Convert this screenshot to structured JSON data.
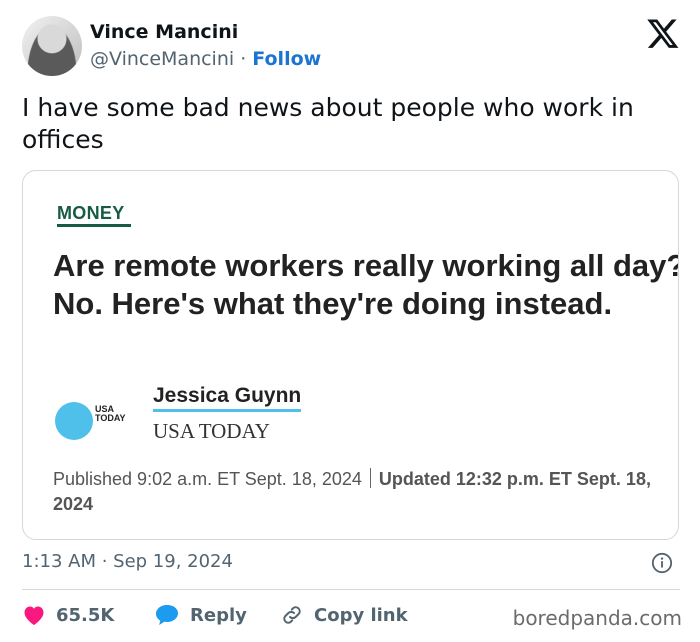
{
  "user": {
    "name": "Vince Mancini",
    "handle": "@VinceMancini",
    "separator": " · ",
    "follow_label": "Follow"
  },
  "tweet": {
    "text": "I have some bad news about people who work in offices"
  },
  "card": {
    "section": "MONEY",
    "headline": "Are remote workers really working all day? No. Here's what they're doing instead.",
    "logo_text": "USA TODAY",
    "author": "Jessica Guynn",
    "outlet": "USA TODAY",
    "published": "Published 9:02 a.m. ET Sept. 18, 2024",
    "updated": "Updated 12:32 p.m. ET Sept. 18, 2024"
  },
  "meta": {
    "timestamp": "1:13 AM · Sep 19, 2024"
  },
  "actions": {
    "likes": "65.5K",
    "reply_label": "Reply",
    "copy_label": "Copy link"
  },
  "watermark": "boredpanda.com",
  "colors": {
    "follow": "#1d74d1",
    "heart": "#f91880",
    "reply": "#1d9bf0",
    "section": "#165c42",
    "usat_blue": "#4fc0ea"
  }
}
